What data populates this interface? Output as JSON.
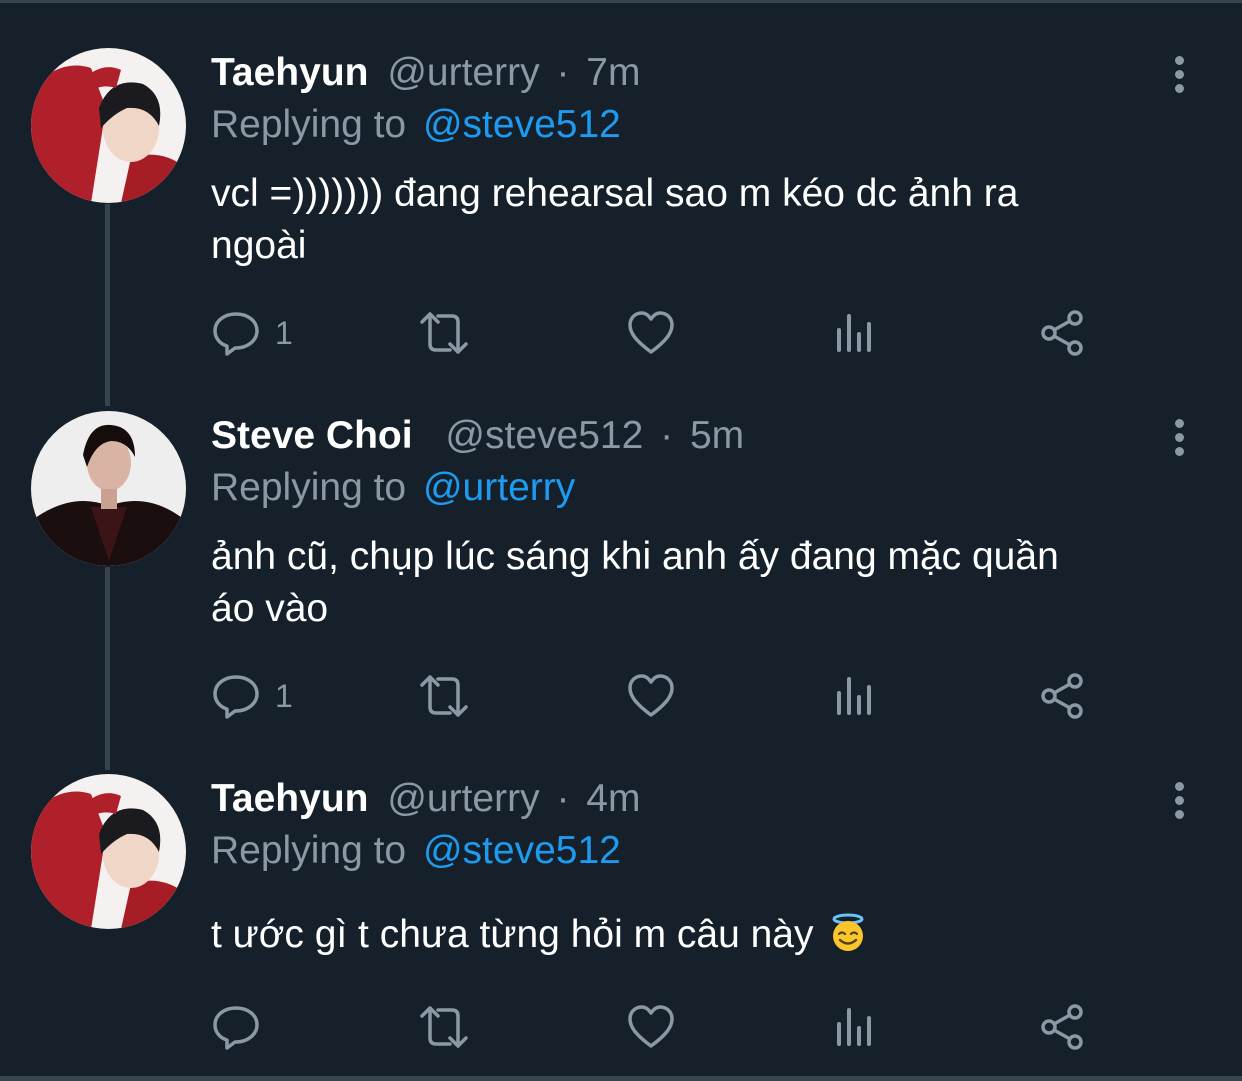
{
  "tweets": [
    {
      "name": "Taehyun",
      "handle": "@urterry",
      "dot": "·",
      "time": "7m",
      "replying_prefix": "Replying to",
      "replying_to": "@steve512",
      "text_line1": "vcl =))))))) đang rehearsal sao m kéo dc ảnh ra",
      "text_line2": "ngoài",
      "reply_count": "1",
      "avatar_theme": "red-jacket"
    },
    {
      "name": "Steve Choi",
      "handle": "@steve512",
      "dot": "·",
      "time": "5m",
      "replying_prefix": "Replying to",
      "replying_to": "@urterry",
      "text_line1": "ảnh cũ, chụp lúc sáng khi anh ấy đang mặc quần",
      "text_line2": "áo vào",
      "reply_count": "1",
      "avatar_theme": "dark-suit"
    },
    {
      "name": "Taehyun",
      "handle": "@urterry",
      "dot": "·",
      "time": "4m",
      "replying_prefix": "Replying to",
      "replying_to": "@steve512",
      "text_line1": "t ước gì t chưa từng hỏi m câu này",
      "text_line2": "",
      "reply_count": "",
      "emoji": "smiling-face-with-halo",
      "avatar_theme": "red-jacket"
    }
  ],
  "icons": {
    "reply": "reply-icon",
    "retweet": "retweet-icon",
    "like": "like-icon",
    "views": "views-icon",
    "share": "share-icon",
    "more": "more-icon"
  },
  "colors": {
    "background": "#15202b",
    "secondary_text": "#8b98a5",
    "mention": "#1d9bf0",
    "divider": "#38444d"
  }
}
